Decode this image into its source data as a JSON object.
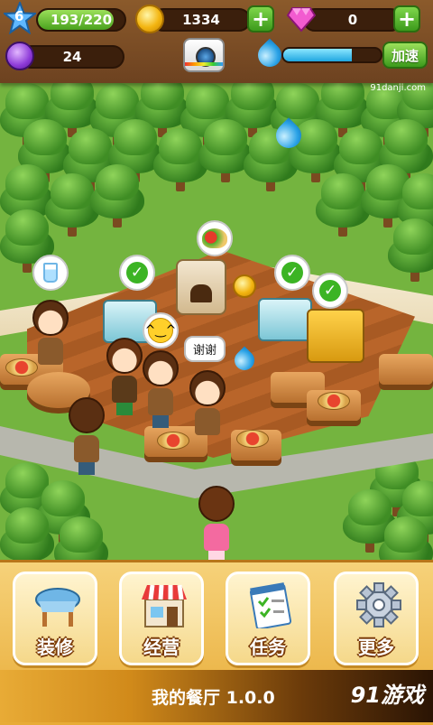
{
  "hud": {
    "level": "6",
    "xp_text": "193/220",
    "xp_progress": 0.877,
    "coins": "1334",
    "gems": "0",
    "potion_count": "24",
    "water_level": 0.7,
    "speed_up_label": "加速"
  },
  "scene": {
    "speech_text": "谢谢"
  },
  "menu": [
    {
      "label": "装修",
      "icon": "decorate-table-icon"
    },
    {
      "label": "经营",
      "icon": "shop-store-icon"
    },
    {
      "label": "任务",
      "icon": "task-list-icon"
    },
    {
      "label": "更多",
      "icon": "gear-icon"
    }
  ],
  "footer": {
    "version": "我的餐厅 1.0.0",
    "watermark": "91游戏",
    "watermark_url": "91danji.com"
  },
  "colors": {
    "hud_bg": "#8b5a2b",
    "accent_green": "#4aa11e",
    "panel_orange": "#e8ab36"
  }
}
